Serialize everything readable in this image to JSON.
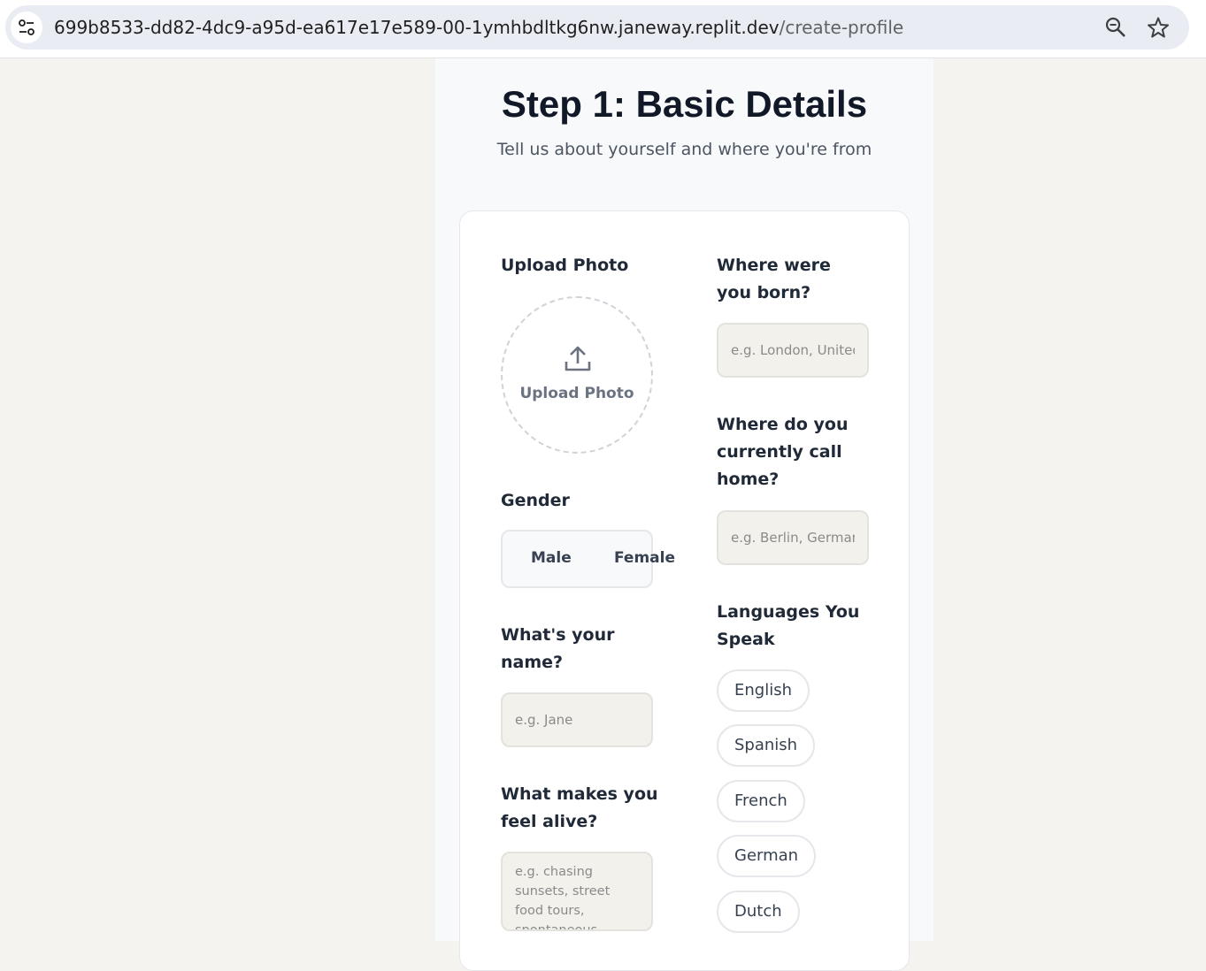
{
  "browser": {
    "url_host": "699b8533-dd82-4dc9-a95d-ea617e17e589-00-1ymhbdltkg6nw.janeway.replit.dev",
    "url_path": "/create-profile"
  },
  "header": {
    "title": "Step 1: Basic Details",
    "subtitle": "Tell us about yourself and where you're from"
  },
  "photo": {
    "label": "Upload Photo",
    "button_label": "Upload Photo"
  },
  "gender": {
    "label": "Gender",
    "options": [
      "Male",
      "Female"
    ]
  },
  "name": {
    "label": "What's your name?",
    "placeholder": "e.g. Jane"
  },
  "alive": {
    "label": "What makes you feel alive?",
    "placeholder": "e.g. chasing sunsets, street food tours, spontaneous hikes..."
  },
  "born": {
    "label": "Where were you born?",
    "placeholder": "e.g. London, United Kingdom"
  },
  "home": {
    "label": "Where do you currently call home?",
    "placeholder": "e.g. Berlin, Germany"
  },
  "languages": {
    "label": "Languages You Speak",
    "options": [
      "English",
      "Spanish",
      "French",
      "German",
      "Dutch"
    ]
  }
}
